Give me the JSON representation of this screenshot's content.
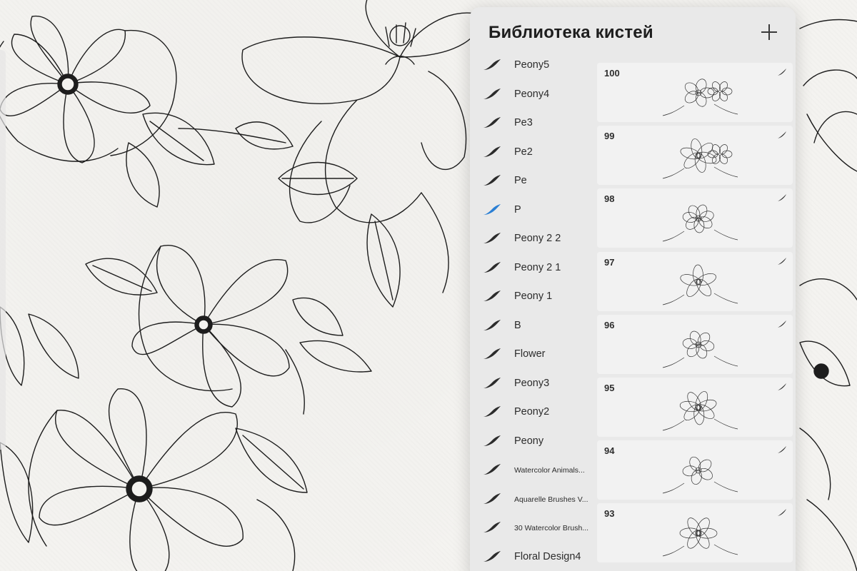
{
  "panel": {
    "title": "Библиотека кистей",
    "add_icon": "plus-icon"
  },
  "brush_sets": [
    {
      "label": "Peony5",
      "selected": false
    },
    {
      "label": "Peony4",
      "selected": false
    },
    {
      "label": "Pe3",
      "selected": false
    },
    {
      "label": "Pe2",
      "selected": false
    },
    {
      "label": "Pe",
      "selected": false
    },
    {
      "label": "P",
      "selected": true
    },
    {
      "label": "Peony 2 2",
      "selected": false
    },
    {
      "label": "Peony 2 1",
      "selected": false
    },
    {
      "label": "Peony 1",
      "selected": false
    },
    {
      "label": "B",
      "selected": false
    },
    {
      "label": "Flower",
      "selected": false
    },
    {
      "label": "Peony3",
      "selected": false
    },
    {
      "label": "Peony2",
      "selected": false
    },
    {
      "label": "Peony",
      "selected": false
    },
    {
      "label": "Watercolor Animals...",
      "selected": false
    },
    {
      "label": "Aquarelle Brushes V...",
      "selected": false
    },
    {
      "label": "30 Watercolor Brush...",
      "selected": false
    },
    {
      "label": "Floral Design4",
      "selected": false
    }
  ],
  "brushes": [
    {
      "number": "100",
      "preview": "floral-bouquet-preview"
    },
    {
      "number": "99",
      "preview": "floral-bouquet-preview"
    },
    {
      "number": "98",
      "preview": "peony-cluster-preview"
    },
    {
      "number": "97",
      "preview": "peony-preview"
    },
    {
      "number": "96",
      "preview": "peony-leaves-preview"
    },
    {
      "number": "95",
      "preview": "peony-stem-preview"
    },
    {
      "number": "94",
      "preview": "peony-bloom-preview"
    },
    {
      "number": "93",
      "preview": "floral-sprig-preview"
    }
  ],
  "colors": {
    "accent": "#2a7fd4",
    "panel_bg": "#e9e9e9",
    "card_bg": "#f2f2f2",
    "icon_dark": "#2b2b2b"
  }
}
